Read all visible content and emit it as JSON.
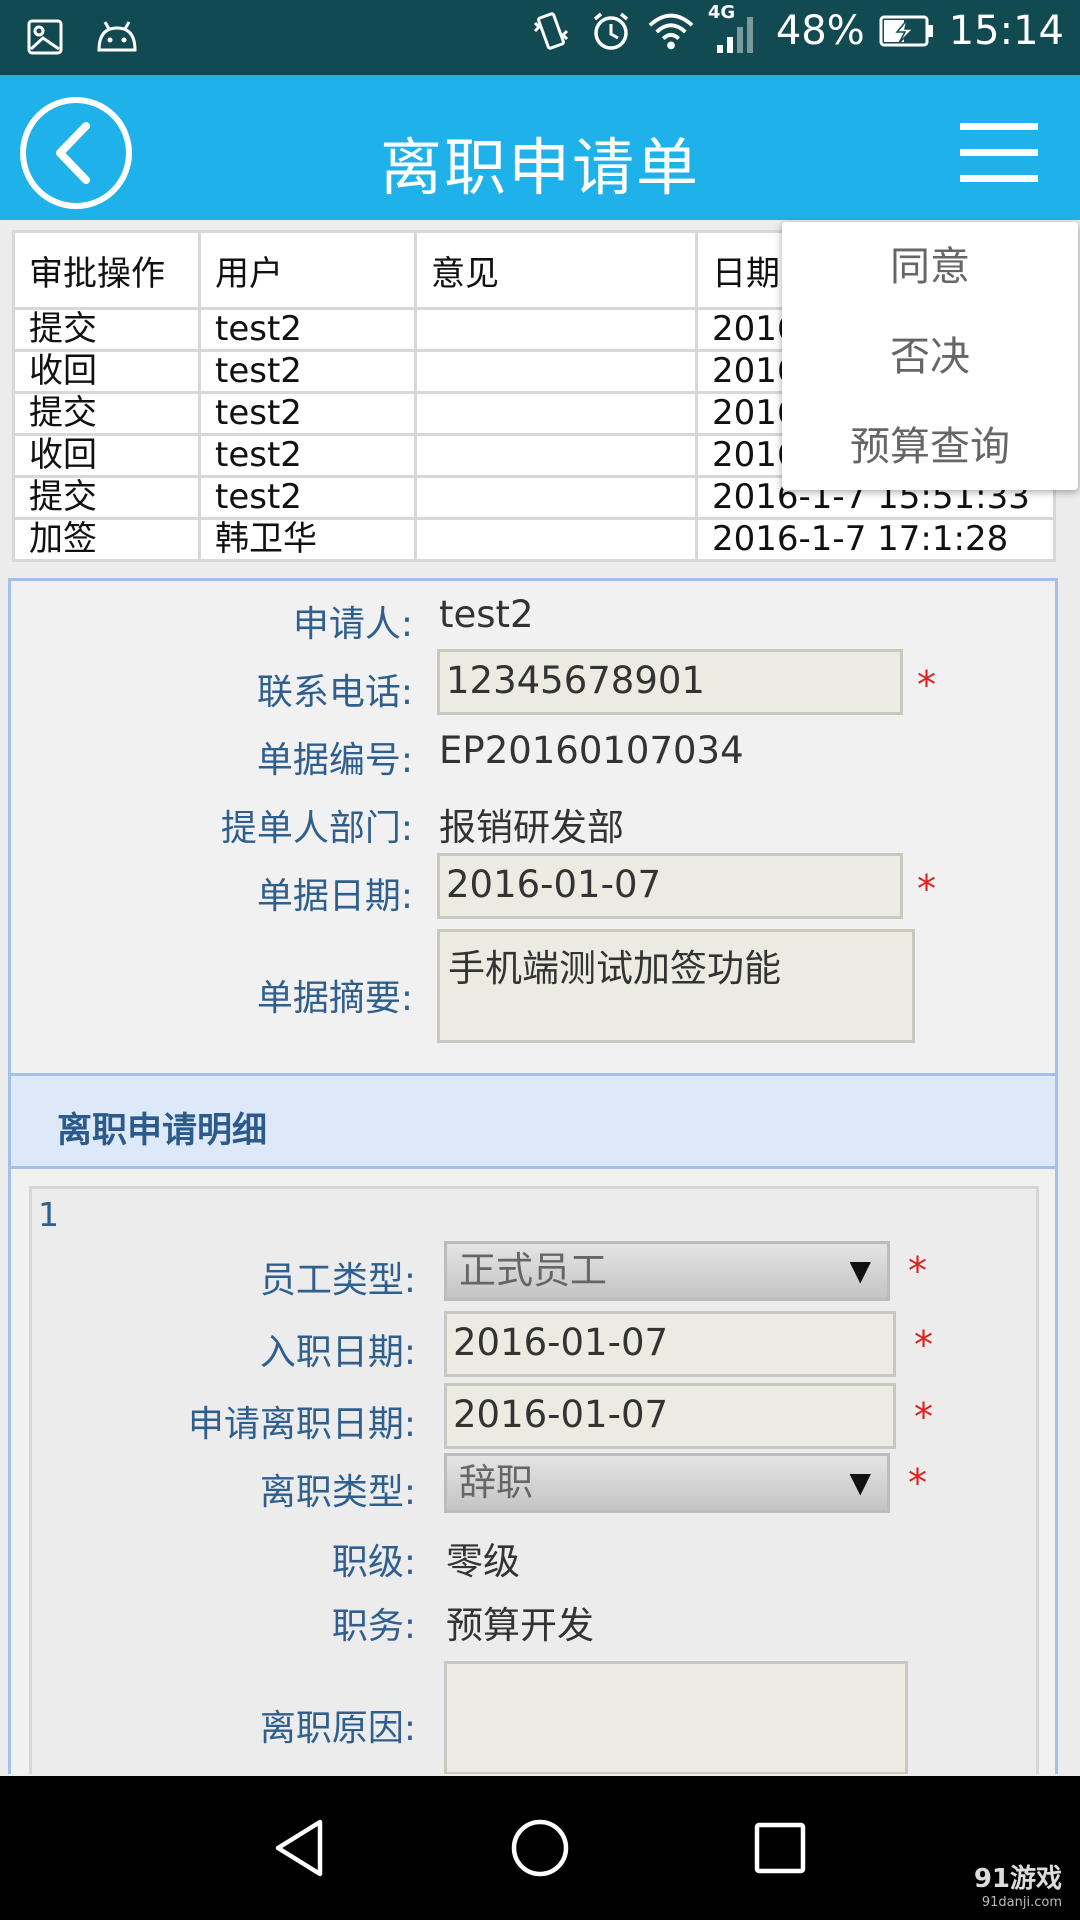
{
  "status_bar": {
    "network": "4G",
    "battery": "48%",
    "time": "15:14"
  },
  "header": {
    "title": "离职申请单"
  },
  "history_table": {
    "columns": [
      "审批操作",
      "用户",
      "意见",
      "日期"
    ],
    "rows": [
      {
        "action": "提交",
        "user": "test2",
        "opinion": "",
        "date": "2016"
      },
      {
        "action": "收回",
        "user": "test2",
        "opinion": "",
        "date": "2016"
      },
      {
        "action": "提交",
        "user": "test2",
        "opinion": "",
        "date": "2016"
      },
      {
        "action": "收回",
        "user": "test2",
        "opinion": "",
        "date": "2016"
      },
      {
        "action": "提交",
        "user": "test2",
        "opinion": "",
        "date": "2016-1-7 15:51:33"
      },
      {
        "action": "加签",
        "user": "韩卫华",
        "opinion": "",
        "date": "2016-1-7 17:1:28"
      }
    ]
  },
  "popup_menu": {
    "items": [
      "同意",
      "否决",
      "预算查询"
    ]
  },
  "form": {
    "applicant_label": "申请人:",
    "applicant_value": "test2",
    "phone_label": "联系电话:",
    "phone_value": "12345678901",
    "doc_no_label": "单据编号:",
    "doc_no_value": "EP20160107034",
    "dept_label": "提单人部门:",
    "dept_value": "报销研发部",
    "doc_date_label": "单据日期:",
    "doc_date_value": "2016-01-07",
    "summary_label": "单据摘要:",
    "summary_value": "手机端测试加签功能",
    "required_mark": "*"
  },
  "detail": {
    "section_title": "离职申请明细",
    "index": "1",
    "emp_type_label": "员工类型:",
    "emp_type_value": "正式员工",
    "hire_date_label": "入职日期:",
    "hire_date_value": "2016-01-07",
    "leave_date_label": "申请离职日期:",
    "leave_date_value": "2016-01-07",
    "leave_type_label": "离职类型:",
    "leave_type_value": "辞职",
    "level_label": "职级:",
    "level_value": "零级",
    "position_label": "职务:",
    "position_value": "预算开发",
    "reason_label": "离职原因:",
    "reason_value": "",
    "dropdown_arrow": "▼"
  },
  "watermark": {
    "brand": "91游戏",
    "site": "91danji.com"
  }
}
